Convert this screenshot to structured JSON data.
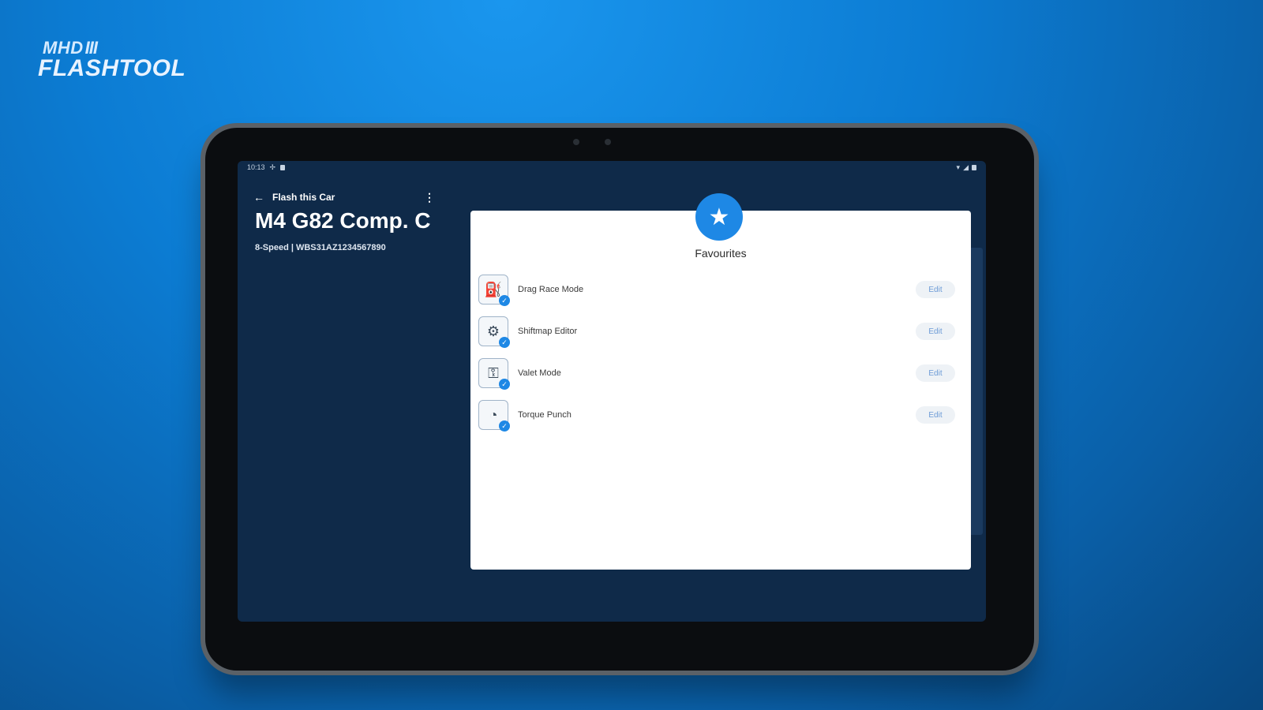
{
  "brand": {
    "badge": "MHD",
    "bars": "III",
    "name": "FLASHTOOL"
  },
  "statusbar": {
    "time": "10:13",
    "icons": [
      "settings-icon",
      "lock-icon"
    ],
    "right_icons": [
      "wifi-icon",
      "signal-icon",
      "battery-icon"
    ]
  },
  "appbar": {
    "title": "Flash this Car",
    "back_icon": "arrow-left-icon",
    "menu_icon": "more-vertical-icon"
  },
  "car": {
    "name": "M4 G82 Comp. C",
    "details": "8-Speed | WBS31AZ1234567890"
  },
  "dialog": {
    "title": "Favourites",
    "badge_icon": "star-icon",
    "items": [
      {
        "label": "Drag Race Mode",
        "icon": "dragrace-icon",
        "edit": "Edit"
      },
      {
        "label": "Shiftmap Editor",
        "icon": "gearbox-icon",
        "edit": "Edit"
      },
      {
        "label": "Valet Mode",
        "icon": "valet-icon",
        "edit": "Edit"
      },
      {
        "label": "Torque Punch",
        "icon": "gauge-icon",
        "edit": "Edit"
      }
    ]
  },
  "colors": {
    "accent": "#1e88e5",
    "screen_bg": "#0f2a49"
  }
}
